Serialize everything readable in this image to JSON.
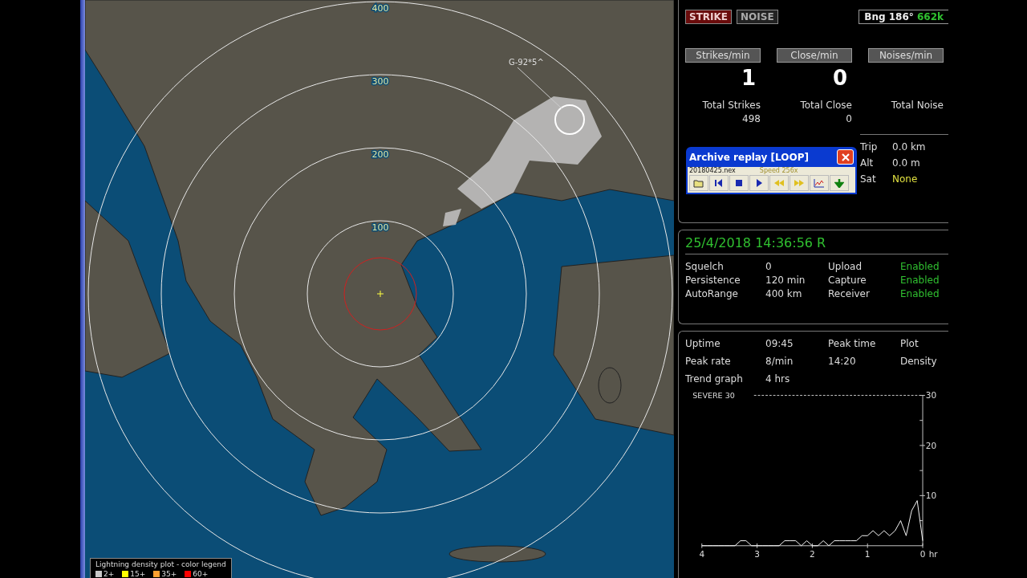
{
  "map": {
    "range_rings": [
      "400",
      "300",
      "200",
      "100"
    ],
    "station_label": "G-92*5^",
    "legend": {
      "title": "Lightning density plot - color legend",
      "items": [
        {
          "label": "2+",
          "color": "#c8c8c8"
        },
        {
          "label": "15+",
          "color": "#ffff00"
        },
        {
          "label": "35+",
          "color": "#ffa030"
        },
        {
          "label": "60+",
          "color": "#ff0000"
        }
      ]
    }
  },
  "mode_buttons": [
    {
      "label": "STRIKE",
      "selected": true
    },
    {
      "label": "NOISE",
      "selected": false
    }
  ],
  "bearing": {
    "label": "Bng 186°",
    "distance": "662k"
  },
  "counters": [
    {
      "label": "Strikes/min",
      "value": "1",
      "total_label": "Total Strikes",
      "total": "498"
    },
    {
      "label": "Close/min",
      "value": "0",
      "total_label": "Total Close",
      "total": "0"
    },
    {
      "label": "Noises/min",
      "total_label": "Total Noise"
    }
  ],
  "archive_replay": {
    "title": "Archive replay [LOOP]",
    "file": "20180425.nex",
    "speed": "Speed 256x"
  },
  "gps": [
    {
      "label": "Trip",
      "value": "0.0 km",
      "kind": "plain"
    },
    {
      "label": "Alt",
      "value": "0.0 m",
      "kind": "plain"
    },
    {
      "label": "Sat",
      "value": "None",
      "kind": "status"
    }
  ],
  "clock": "25/4/2018 14:36:56 R",
  "settings": [
    {
      "label": "Squelch",
      "value": "0",
      "feature": "Upload",
      "state": "Enabled"
    },
    {
      "label": "Persistence",
      "value": "120 min",
      "feature": "Capture",
      "state": "Enabled"
    },
    {
      "label": "AutoRange",
      "value": "400 km",
      "feature": "Receiver",
      "state": "Enabled"
    }
  ],
  "stats": [
    {
      "label": "Uptime",
      "value": "09:45",
      "label_2": "Peak time",
      "value_2": "Plot"
    },
    {
      "label": "Peak rate",
      "value": "8/min",
      "label_2": "14:20",
      "value_2": "Density"
    }
  ],
  "trend": {
    "label": "Trend graph",
    "span": "4 hrs",
    "severe_label": "SEVERE 30",
    "chart_data": {
      "type": "line",
      "xlabel": "hr",
      "x": [
        4,
        3.9,
        3.8,
        3.7,
        3.6,
        3.5,
        3.4,
        3.3,
        3.2,
        3.1,
        3,
        2.9,
        2.8,
        2.7,
        2.6,
        2.5,
        2.4,
        2.3,
        2.2,
        2.1,
        2,
        1.9,
        1.8,
        1.7,
        1.6,
        1.5,
        1.4,
        1.3,
        1.2,
        1.1,
        1,
        0.9,
        0.8,
        0.7,
        0.6,
        0.5,
        0.4,
        0.3,
        0.2,
        0.1,
        0
      ],
      "series": [
        {
          "color": "#ffffff",
          "values": [
            0,
            0,
            0,
            0,
            0,
            0,
            0,
            1,
            1,
            0,
            0,
            0,
            0,
            0,
            0,
            1,
            1,
            1,
            0,
            1,
            0,
            0,
            1,
            0,
            1,
            1,
            1,
            1,
            1,
            2,
            2,
            3,
            2,
            3,
            2,
            3,
            5,
            2,
            7,
            9,
            1
          ]
        }
      ],
      "xlim": [
        4,
        0
      ],
      "ylim": [
        0,
        30
      ],
      "xticks": [
        4,
        3,
        2,
        1,
        0
      ],
      "yticks": [
        10,
        20,
        30
      ]
    }
  }
}
